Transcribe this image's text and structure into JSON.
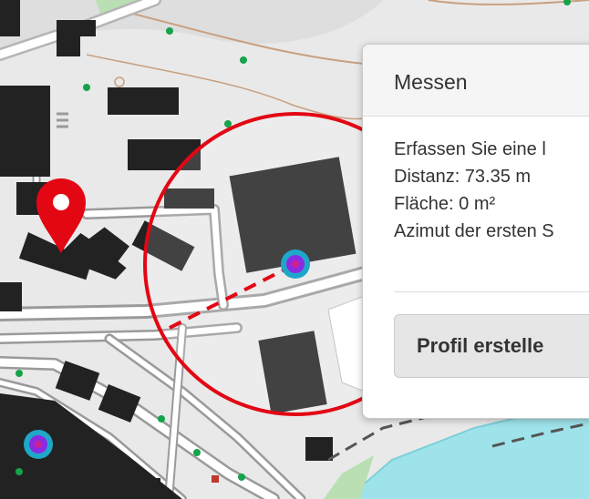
{
  "panel": {
    "title": "Messen",
    "instruction": "Erfassen Sie eine l",
    "distance": "Distanz: 73.35 m",
    "area": "Fläche: 0 m²",
    "azimuth": "Azimut der ersten S",
    "profile_button_label": "Profil erstelle"
  },
  "colors": {
    "measure_line": "#e30613",
    "vertex_outer": "#1fa7c9",
    "vertex_inner": "#8a2be2",
    "marker": "#e30613",
    "water": "#9fe3ea"
  }
}
